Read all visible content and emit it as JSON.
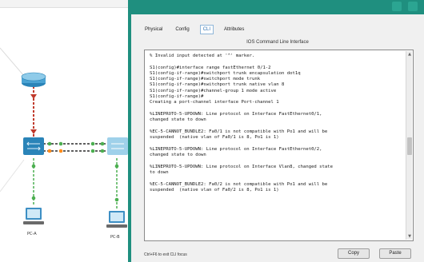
{
  "topology": {
    "devices": [
      {
        "label": ""
      },
      {
        "label": ""
      },
      {
        "label": ""
      },
      {
        "label": "PC-A"
      },
      {
        "label": "PC-B"
      }
    ]
  },
  "window": {
    "title": "",
    "accent": "#1f8f7f"
  },
  "tabs": [
    {
      "label": "Physical"
    },
    {
      "label": "Config"
    },
    {
      "label": "CLI"
    },
    {
      "label": "Attributes"
    }
  ],
  "active_tab": "CLI",
  "ios": {
    "title": "IOS Command Line Interface",
    "lines": [
      "% Invalid input detected at '^' marker.",
      "",
      "S1(config)#interface range fastEthernet 0/1-2",
      "S1(config-if-range)#switchport trunk encapsulation dot1q",
      "S1(config-if-range)#switchport mode trunk",
      "S1(config-if-range)#switchport trunk native vlan 8",
      "S1(config-if-range)#channel-group 1 mode active",
      "S1(config-if-range)#",
      "Creating a port-channel interface Port-channel 1",
      "",
      "%LINEPROTO-5-UPDOWN: Line protocol on Interface FastEthernet0/1,",
      "changed state to down",
      "",
      "%EC-5-CANNOT_BUNDLE2: Fa0/1 is not compatible with Po1 and will be",
      "suspended  (native vlan of Fa0/1 is 8, Po1 is 1)",
      "",
      "%LINEPROTO-5-UPDOWN: Line protocol on Interface FastEthernet0/2,",
      "changed state to down",
      "",
      "%LINEPROTO-5-UPDOWN: Line protocol on Interface Vlan8, changed state",
      "to down",
      "",
      "%EC-5-CANNOT_BUNDLE2: Fa0/2 is not compatible with Po1 and will be",
      "suspended  (native vlan of Fa0/2 is 8, Po1 is 1)",
      ""
    ]
  },
  "footer": {
    "hint": "Ctrl+F6 to exit CLI focus",
    "copy_label": "Copy",
    "paste_label": "Paste"
  }
}
